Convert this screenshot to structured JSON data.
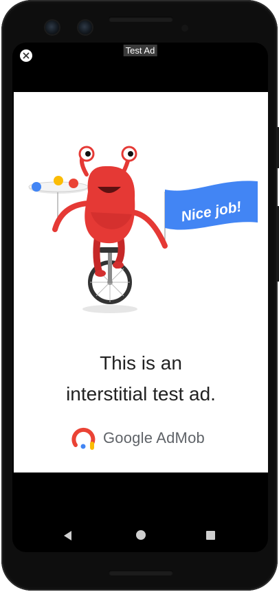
{
  "ad_header": {
    "label": "Test Ad"
  },
  "illustration": {
    "flag_text": "Nice job!"
  },
  "ad_body": {
    "line1": "This is an",
    "line2": "interstitial test ad."
  },
  "brand": {
    "name": "Google AdMob"
  },
  "colors": {
    "monster": "#e53935",
    "flag": "#4285f4",
    "ball_blue": "#4285f4",
    "ball_yellow": "#fbbc04",
    "ball_red": "#ea4335"
  },
  "navigation": {
    "icons": [
      "back-icon",
      "home-icon",
      "recents-icon"
    ]
  }
}
